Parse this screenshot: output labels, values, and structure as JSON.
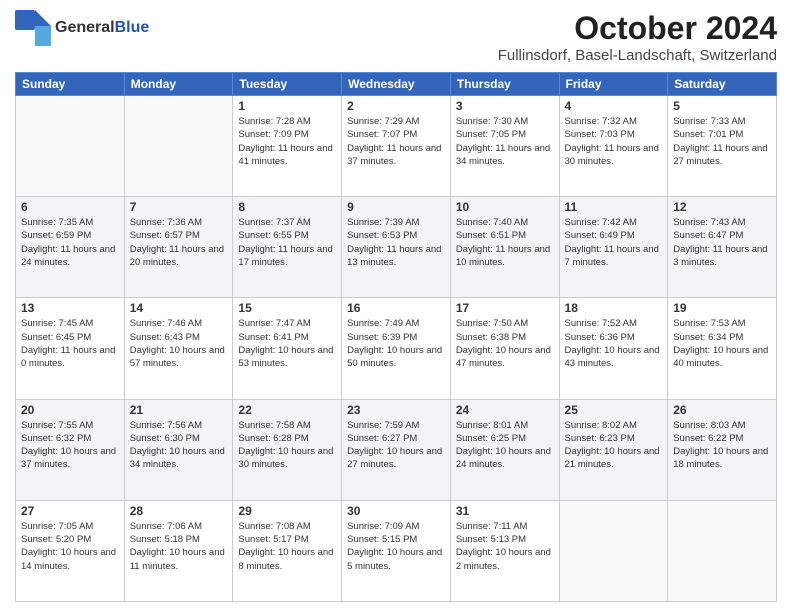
{
  "header": {
    "logo_general": "General",
    "logo_blue": "Blue",
    "main_title": "October 2024",
    "subtitle": "Fullinsdorf, Basel-Landschaft, Switzerland"
  },
  "weekdays": [
    "Sunday",
    "Monday",
    "Tuesday",
    "Wednesday",
    "Thursday",
    "Friday",
    "Saturday"
  ],
  "weeks": [
    [
      {
        "day": "",
        "sunrise": "",
        "sunset": "",
        "daylight": ""
      },
      {
        "day": "",
        "sunrise": "",
        "sunset": "",
        "daylight": ""
      },
      {
        "day": "1",
        "sunrise": "Sunrise: 7:28 AM",
        "sunset": "Sunset: 7:09 PM",
        "daylight": "Daylight: 11 hours and 41 minutes."
      },
      {
        "day": "2",
        "sunrise": "Sunrise: 7:29 AM",
        "sunset": "Sunset: 7:07 PM",
        "daylight": "Daylight: 11 hours and 37 minutes."
      },
      {
        "day": "3",
        "sunrise": "Sunrise: 7:30 AM",
        "sunset": "Sunset: 7:05 PM",
        "daylight": "Daylight: 11 hours and 34 minutes."
      },
      {
        "day": "4",
        "sunrise": "Sunrise: 7:32 AM",
        "sunset": "Sunset: 7:03 PM",
        "daylight": "Daylight: 11 hours and 30 minutes."
      },
      {
        "day": "5",
        "sunrise": "Sunrise: 7:33 AM",
        "sunset": "Sunset: 7:01 PM",
        "daylight": "Daylight: 11 hours and 27 minutes."
      }
    ],
    [
      {
        "day": "6",
        "sunrise": "Sunrise: 7:35 AM",
        "sunset": "Sunset: 6:59 PM",
        "daylight": "Daylight: 11 hours and 24 minutes."
      },
      {
        "day": "7",
        "sunrise": "Sunrise: 7:36 AM",
        "sunset": "Sunset: 6:57 PM",
        "daylight": "Daylight: 11 hours and 20 minutes."
      },
      {
        "day": "8",
        "sunrise": "Sunrise: 7:37 AM",
        "sunset": "Sunset: 6:55 PM",
        "daylight": "Daylight: 11 hours and 17 minutes."
      },
      {
        "day": "9",
        "sunrise": "Sunrise: 7:39 AM",
        "sunset": "Sunset: 6:53 PM",
        "daylight": "Daylight: 11 hours and 13 minutes."
      },
      {
        "day": "10",
        "sunrise": "Sunrise: 7:40 AM",
        "sunset": "Sunset: 6:51 PM",
        "daylight": "Daylight: 11 hours and 10 minutes."
      },
      {
        "day": "11",
        "sunrise": "Sunrise: 7:42 AM",
        "sunset": "Sunset: 6:49 PM",
        "daylight": "Daylight: 11 hours and 7 minutes."
      },
      {
        "day": "12",
        "sunrise": "Sunrise: 7:43 AM",
        "sunset": "Sunset: 6:47 PM",
        "daylight": "Daylight: 11 hours and 3 minutes."
      }
    ],
    [
      {
        "day": "13",
        "sunrise": "Sunrise: 7:45 AM",
        "sunset": "Sunset: 6:45 PM",
        "daylight": "Daylight: 11 hours and 0 minutes."
      },
      {
        "day": "14",
        "sunrise": "Sunrise: 7:46 AM",
        "sunset": "Sunset: 6:43 PM",
        "daylight": "Daylight: 10 hours and 57 minutes."
      },
      {
        "day": "15",
        "sunrise": "Sunrise: 7:47 AM",
        "sunset": "Sunset: 6:41 PM",
        "daylight": "Daylight: 10 hours and 53 minutes."
      },
      {
        "day": "16",
        "sunrise": "Sunrise: 7:49 AM",
        "sunset": "Sunset: 6:39 PM",
        "daylight": "Daylight: 10 hours and 50 minutes."
      },
      {
        "day": "17",
        "sunrise": "Sunrise: 7:50 AM",
        "sunset": "Sunset: 6:38 PM",
        "daylight": "Daylight: 10 hours and 47 minutes."
      },
      {
        "day": "18",
        "sunrise": "Sunrise: 7:52 AM",
        "sunset": "Sunset: 6:36 PM",
        "daylight": "Daylight: 10 hours and 43 minutes."
      },
      {
        "day": "19",
        "sunrise": "Sunrise: 7:53 AM",
        "sunset": "Sunset: 6:34 PM",
        "daylight": "Daylight: 10 hours and 40 minutes."
      }
    ],
    [
      {
        "day": "20",
        "sunrise": "Sunrise: 7:55 AM",
        "sunset": "Sunset: 6:32 PM",
        "daylight": "Daylight: 10 hours and 37 minutes."
      },
      {
        "day": "21",
        "sunrise": "Sunrise: 7:56 AM",
        "sunset": "Sunset: 6:30 PM",
        "daylight": "Daylight: 10 hours and 34 minutes."
      },
      {
        "day": "22",
        "sunrise": "Sunrise: 7:58 AM",
        "sunset": "Sunset: 6:28 PM",
        "daylight": "Daylight: 10 hours and 30 minutes."
      },
      {
        "day": "23",
        "sunrise": "Sunrise: 7:59 AM",
        "sunset": "Sunset: 6:27 PM",
        "daylight": "Daylight: 10 hours and 27 minutes."
      },
      {
        "day": "24",
        "sunrise": "Sunrise: 8:01 AM",
        "sunset": "Sunset: 6:25 PM",
        "daylight": "Daylight: 10 hours and 24 minutes."
      },
      {
        "day": "25",
        "sunrise": "Sunrise: 8:02 AM",
        "sunset": "Sunset: 6:23 PM",
        "daylight": "Daylight: 10 hours and 21 minutes."
      },
      {
        "day": "26",
        "sunrise": "Sunrise: 8:03 AM",
        "sunset": "Sunset: 6:22 PM",
        "daylight": "Daylight: 10 hours and 18 minutes."
      }
    ],
    [
      {
        "day": "27",
        "sunrise": "Sunrise: 7:05 AM",
        "sunset": "Sunset: 5:20 PM",
        "daylight": "Daylight: 10 hours and 14 minutes."
      },
      {
        "day": "28",
        "sunrise": "Sunrise: 7:06 AM",
        "sunset": "Sunset: 5:18 PM",
        "daylight": "Daylight: 10 hours and 11 minutes."
      },
      {
        "day": "29",
        "sunrise": "Sunrise: 7:08 AM",
        "sunset": "Sunset: 5:17 PM",
        "daylight": "Daylight: 10 hours and 8 minutes."
      },
      {
        "day": "30",
        "sunrise": "Sunrise: 7:09 AM",
        "sunset": "Sunset: 5:15 PM",
        "daylight": "Daylight: 10 hours and 5 minutes."
      },
      {
        "day": "31",
        "sunrise": "Sunrise: 7:11 AM",
        "sunset": "Sunset: 5:13 PM",
        "daylight": "Daylight: 10 hours and 2 minutes."
      },
      {
        "day": "",
        "sunrise": "",
        "sunset": "",
        "daylight": ""
      },
      {
        "day": "",
        "sunrise": "",
        "sunset": "",
        "daylight": ""
      }
    ]
  ]
}
